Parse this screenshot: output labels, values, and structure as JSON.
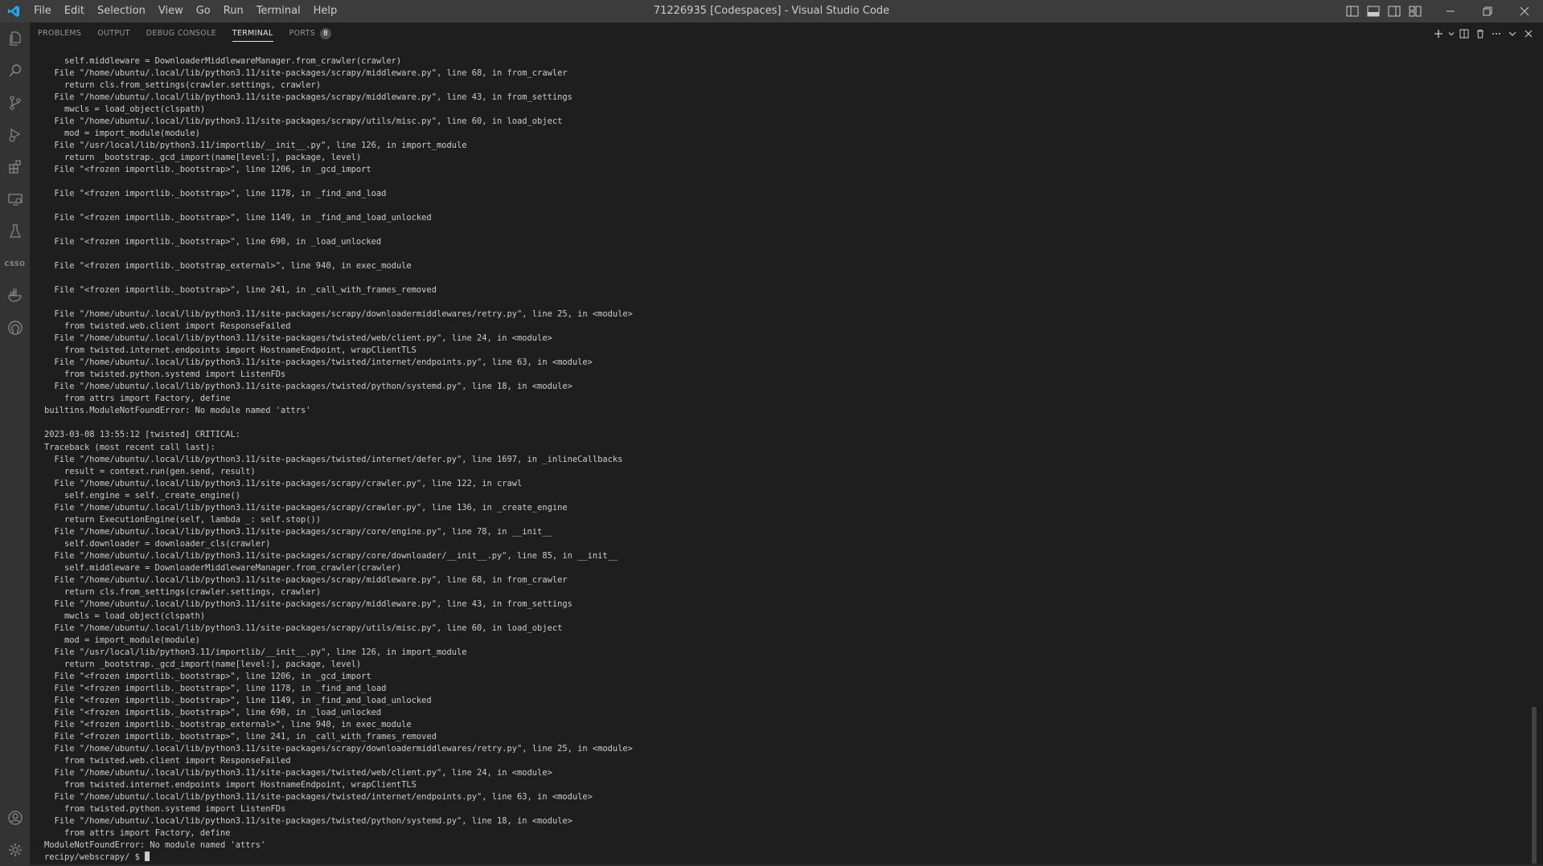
{
  "titlebar": {
    "menu": [
      "File",
      "Edit",
      "Selection",
      "View",
      "Go",
      "Run",
      "Terminal",
      "Help"
    ],
    "title": "71226935 [Codespaces] - Visual Studio Code"
  },
  "activitybar": {
    "badge_text": "CSSO"
  },
  "panel": {
    "tabs": [
      "PROBLEMS",
      "OUTPUT",
      "DEBUG CONSOLE",
      "TERMINAL",
      "PORTS"
    ],
    "ports_badge": "8"
  },
  "terminal": {
    "lines": [
      "    self.middleware = DownloaderMiddlewareManager.from_crawler(crawler)",
      "  File \"/home/ubuntu/.local/lib/python3.11/site-packages/scrapy/middleware.py\", line 68, in from_crawler",
      "    return cls.from_settings(crawler.settings, crawler)",
      "  File \"/home/ubuntu/.local/lib/python3.11/site-packages/scrapy/middleware.py\", line 43, in from_settings",
      "    mwcls = load_object(clspath)",
      "  File \"/home/ubuntu/.local/lib/python3.11/site-packages/scrapy/utils/misc.py\", line 60, in load_object",
      "    mod = import_module(module)",
      "  File \"/usr/local/lib/python3.11/importlib/__init__.py\", line 126, in import_module",
      "    return _bootstrap._gcd_import(name[level:], package, level)",
      "  File \"<frozen importlib._bootstrap>\", line 1206, in _gcd_import",
      "",
      "  File \"<frozen importlib._bootstrap>\", line 1178, in _find_and_load",
      "",
      "  File \"<frozen importlib._bootstrap>\", line 1149, in _find_and_load_unlocked",
      "",
      "  File \"<frozen importlib._bootstrap>\", line 690, in _load_unlocked",
      "",
      "  File \"<frozen importlib._bootstrap_external>\", line 940, in exec_module",
      "",
      "  File \"<frozen importlib._bootstrap>\", line 241, in _call_with_frames_removed",
      "",
      "  File \"/home/ubuntu/.local/lib/python3.11/site-packages/scrapy/downloadermiddlewares/retry.py\", line 25, in <module>",
      "    from twisted.web.client import ResponseFailed",
      "  File \"/home/ubuntu/.local/lib/python3.11/site-packages/twisted/web/client.py\", line 24, in <module>",
      "    from twisted.internet.endpoints import HostnameEndpoint, wrapClientTLS",
      "  File \"/home/ubuntu/.local/lib/python3.11/site-packages/twisted/internet/endpoints.py\", line 63, in <module>",
      "    from twisted.python.systemd import ListenFDs",
      "  File \"/home/ubuntu/.local/lib/python3.11/site-packages/twisted/python/systemd.py\", line 18, in <module>",
      "    from attrs import Factory, define",
      "builtins.ModuleNotFoundError: No module named 'attrs'",
      "",
      "2023-03-08 13:55:12 [twisted] CRITICAL:",
      "Traceback (most recent call last):",
      "  File \"/home/ubuntu/.local/lib/python3.11/site-packages/twisted/internet/defer.py\", line 1697, in _inlineCallbacks",
      "    result = context.run(gen.send, result)",
      "  File \"/home/ubuntu/.local/lib/python3.11/site-packages/scrapy/crawler.py\", line 122, in crawl",
      "    self.engine = self._create_engine()",
      "  File \"/home/ubuntu/.local/lib/python3.11/site-packages/scrapy/crawler.py\", line 136, in _create_engine",
      "    return ExecutionEngine(self, lambda _: self.stop())",
      "  File \"/home/ubuntu/.local/lib/python3.11/site-packages/scrapy/core/engine.py\", line 78, in __init__",
      "    self.downloader = downloader_cls(crawler)",
      "  File \"/home/ubuntu/.local/lib/python3.11/site-packages/scrapy/core/downloader/__init__.py\", line 85, in __init__",
      "    self.middleware = DownloaderMiddlewareManager.from_crawler(crawler)",
      "  File \"/home/ubuntu/.local/lib/python3.11/site-packages/scrapy/middleware.py\", line 68, in from_crawler",
      "    return cls.from_settings(crawler.settings, crawler)",
      "  File \"/home/ubuntu/.local/lib/python3.11/site-packages/scrapy/middleware.py\", line 43, in from_settings",
      "    mwcls = load_object(clspath)",
      "  File \"/home/ubuntu/.local/lib/python3.11/site-packages/scrapy/utils/misc.py\", line 60, in load_object",
      "    mod = import_module(module)",
      "  File \"/usr/local/lib/python3.11/importlib/__init__.py\", line 126, in import_module",
      "    return _bootstrap._gcd_import(name[level:], package, level)",
      "  File \"<frozen importlib._bootstrap>\", line 1206, in _gcd_import",
      "  File \"<frozen importlib._bootstrap>\", line 1178, in _find_and_load",
      "  File \"<frozen importlib._bootstrap>\", line 1149, in _find_and_load_unlocked",
      "  File \"<frozen importlib._bootstrap>\", line 690, in _load_unlocked",
      "  File \"<frozen importlib._bootstrap_external>\", line 940, in exec_module",
      "  File \"<frozen importlib._bootstrap>\", line 241, in _call_with_frames_removed",
      "  File \"/home/ubuntu/.local/lib/python3.11/site-packages/scrapy/downloadermiddlewares/retry.py\", line 25, in <module>",
      "    from twisted.web.client import ResponseFailed",
      "  File \"/home/ubuntu/.local/lib/python3.11/site-packages/twisted/web/client.py\", line 24, in <module>",
      "    from twisted.internet.endpoints import HostnameEndpoint, wrapClientTLS",
      "  File \"/home/ubuntu/.local/lib/python3.11/site-packages/twisted/internet/endpoints.py\", line 63, in <module>",
      "    from twisted.python.systemd import ListenFDs",
      "  File \"/home/ubuntu/.local/lib/python3.11/site-packages/twisted/python/systemd.py\", line 18, in <module>",
      "    from attrs import Factory, define",
      "ModuleNotFoundError: No module named 'attrs'"
    ],
    "prompt": "recipy/webscrapy/ $ "
  },
  "colors": {
    "titlebar_bg": "#3c3c3c",
    "activitybar_bg": "#333333",
    "editor_bg": "#1e1e1e",
    "text": "#cccccc",
    "logo_blue": "#23a9f2"
  },
  "icons": {
    "activity": [
      "explorer-icon",
      "search-icon",
      "source-control-icon",
      "run-debug-icon",
      "extensions-icon",
      "remote-explorer-icon",
      "testing-icon",
      "csso-icon",
      "docker-icon",
      "github-icon",
      "account-icon",
      "settings-gear-icon"
    ],
    "panel_actions": [
      "plus-icon",
      "chevron-down-icon",
      "split-terminal-icon",
      "trash-icon",
      "more-icon",
      "maximize-icon",
      "close-icon"
    ]
  }
}
